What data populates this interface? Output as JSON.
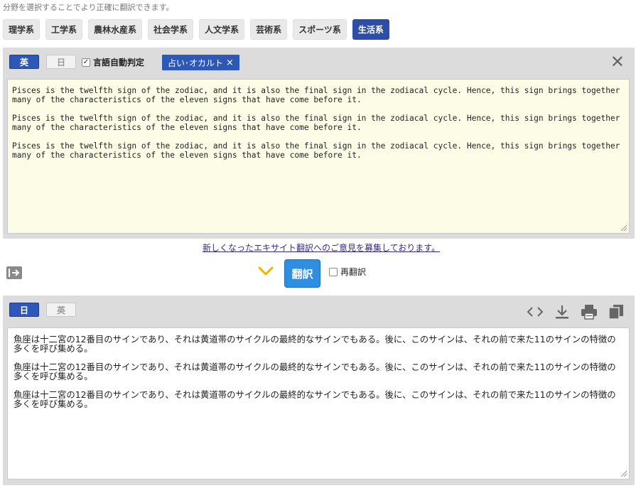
{
  "hint": "分野を選択することでより正確に翻訳できます。",
  "categories": [
    {
      "label": "理学系",
      "active": false
    },
    {
      "label": "工学系",
      "active": false
    },
    {
      "label": "農林水産系",
      "active": false
    },
    {
      "label": "社会学系",
      "active": false
    },
    {
      "label": "人文学系",
      "active": false
    },
    {
      "label": "芸術系",
      "active": false
    },
    {
      "label": "スポーツ系",
      "active": false
    },
    {
      "label": "生活系",
      "active": true
    }
  ],
  "source": {
    "lang_primary": "英",
    "lang_secondary": "日",
    "auto_detect_label": "言語自動判定",
    "auto_detect_checked": true,
    "domain_tag": "占い･オカルト",
    "paragraphs": [
      "Pisces is the twelfth sign of the zodiac, and it is also the final sign in the zodiacal cycle. Hence, this sign brings together many of the characteristics of the eleven signs that have come before it.",
      "Pisces is the twelfth sign of the zodiac, and it is also the final sign in the zodiacal cycle. Hence, this sign brings together many of the characteristics of the eleven signs that have come before it.",
      "Pisces is the twelfth sign of the zodiac, and it is also the final sign in the zodiacal cycle. Hence, this sign brings together many of the characteristics of the eleven signs that have come before it."
    ]
  },
  "feedback_link": "新しくなったエキサイト翻訳へのご意見を募集しております。",
  "translate_button": "翻訳",
  "retranslate_label": "再翻訳",
  "target": {
    "lang_primary": "日",
    "lang_secondary": "英",
    "paragraphs": [
      "魚座は十二宮の12番目のサインであり、それは黄道帯のサイクルの最終的なサインでもある。後に、このサインは、それの前で来た11のサインの特徴の多くを呼び集める。",
      "魚座は十二宮の12番目のサインであり、それは黄道帯のサイクルの最終的なサインでもある。後に、このサインは、それの前で来た11のサインの特徴の多くを呼び集める。",
      "魚座は十二宮の12番目のサインであり、それは黄道帯のサイクルの最終的なサインでもある。後に、このサインは、それの前で来た11のサインの特徴の多くを呼び集める。"
    ]
  },
  "icons": {
    "swap": "swap-direction-icon",
    "chevron": "chevron-down-icon",
    "code": "code-icon",
    "download": "download-icon",
    "print": "print-icon",
    "copy": "copy-icon"
  },
  "colors": {
    "accent": "#2d58b8",
    "translate_button": "#2f8ee0",
    "source_bg": "#fdfde7",
    "panel_bg": "#dcdcdc",
    "chevron": "#f0b400"
  }
}
